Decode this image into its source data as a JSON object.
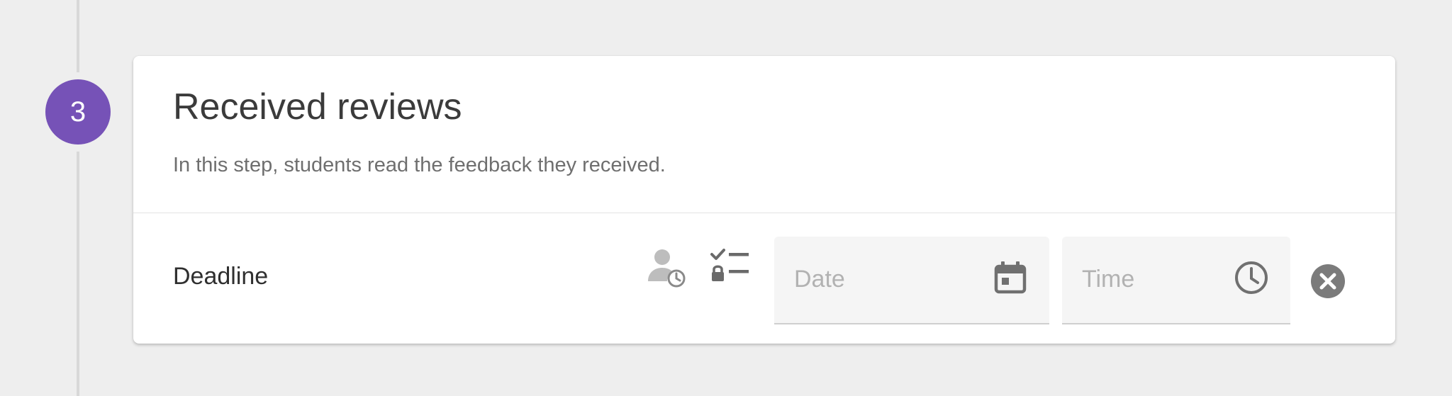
{
  "step": {
    "number": "3",
    "badge_color": "#7652b7"
  },
  "card": {
    "title": "Received reviews",
    "subtitle": "In this step, students read the feedback they received."
  },
  "deadline": {
    "label": "Deadline",
    "personal_deadline_icon": "person-clock-icon",
    "lock_checklist_icon": "lock-checklist-icon",
    "date_placeholder": "Date",
    "date_value": "",
    "date_icon": "calendar-icon",
    "time_placeholder": "Time",
    "time_value": "",
    "time_icon": "clock-icon",
    "clear_icon": "close-circle-icon"
  }
}
